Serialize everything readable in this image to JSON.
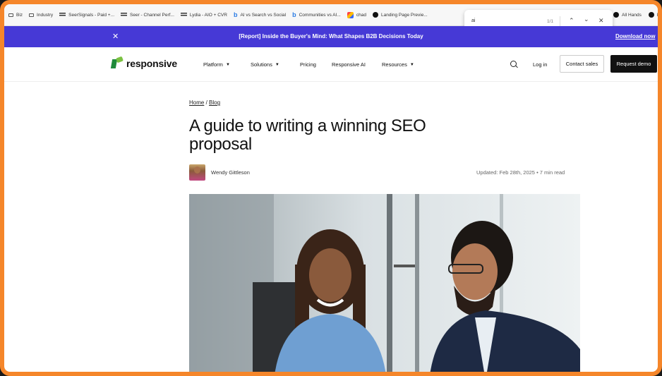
{
  "bookmarks": [
    {
      "label": "Biz",
      "icon": "folder-icon"
    },
    {
      "label": "Industry",
      "icon": "folder-icon"
    },
    {
      "label": "SeerSignals - Paid +...",
      "icon": "seer-icon"
    },
    {
      "label": "Seer - Channel Perf...",
      "icon": "seer-icon"
    },
    {
      "label": "Lydia - AIO + CVR",
      "icon": "seer-icon"
    },
    {
      "label": "AI vs Search vs Social",
      "icon": "b-icon"
    },
    {
      "label": "Communities vs AI...",
      "icon": "b-icon"
    },
    {
      "label": "chad",
      "icon": "chad-icon"
    },
    {
      "label": "Landing Page Previe...",
      "icon": "circle-icon"
    }
  ],
  "bookmarks_right": [
    {
      "label": "All Hands"
    },
    {
      "label": "Le"
    }
  ],
  "find": {
    "query": "ai",
    "count": "1/1"
  },
  "announcement": {
    "text": "[Report] Inside the Buyer's Mind: What Shapes B2B Decisions Today",
    "cta": "Download now"
  },
  "nav": {
    "logo": "responsive",
    "items": [
      {
        "label": "Platform",
        "dropdown": true
      },
      {
        "label": "Solutions",
        "dropdown": true
      },
      {
        "label": "Pricing",
        "dropdown": false
      },
      {
        "label": "Responsive AI",
        "dropdown": false
      },
      {
        "label": "Resources",
        "dropdown": true
      }
    ],
    "login": "Log in",
    "contact": "Contact sales",
    "demo": "Request demo"
  },
  "article": {
    "breadcrumb": [
      "Home",
      "Blog"
    ],
    "title": "A guide to writing a winning SEO proposal",
    "author": "Wendy Gittleson",
    "updated": "Updated: Feb 28th, 2025",
    "read_time": "7 min read"
  },
  "colors": {
    "accent": "#4639d6",
    "frame": "#f5862a",
    "logo_green": "#1f8a3a"
  }
}
